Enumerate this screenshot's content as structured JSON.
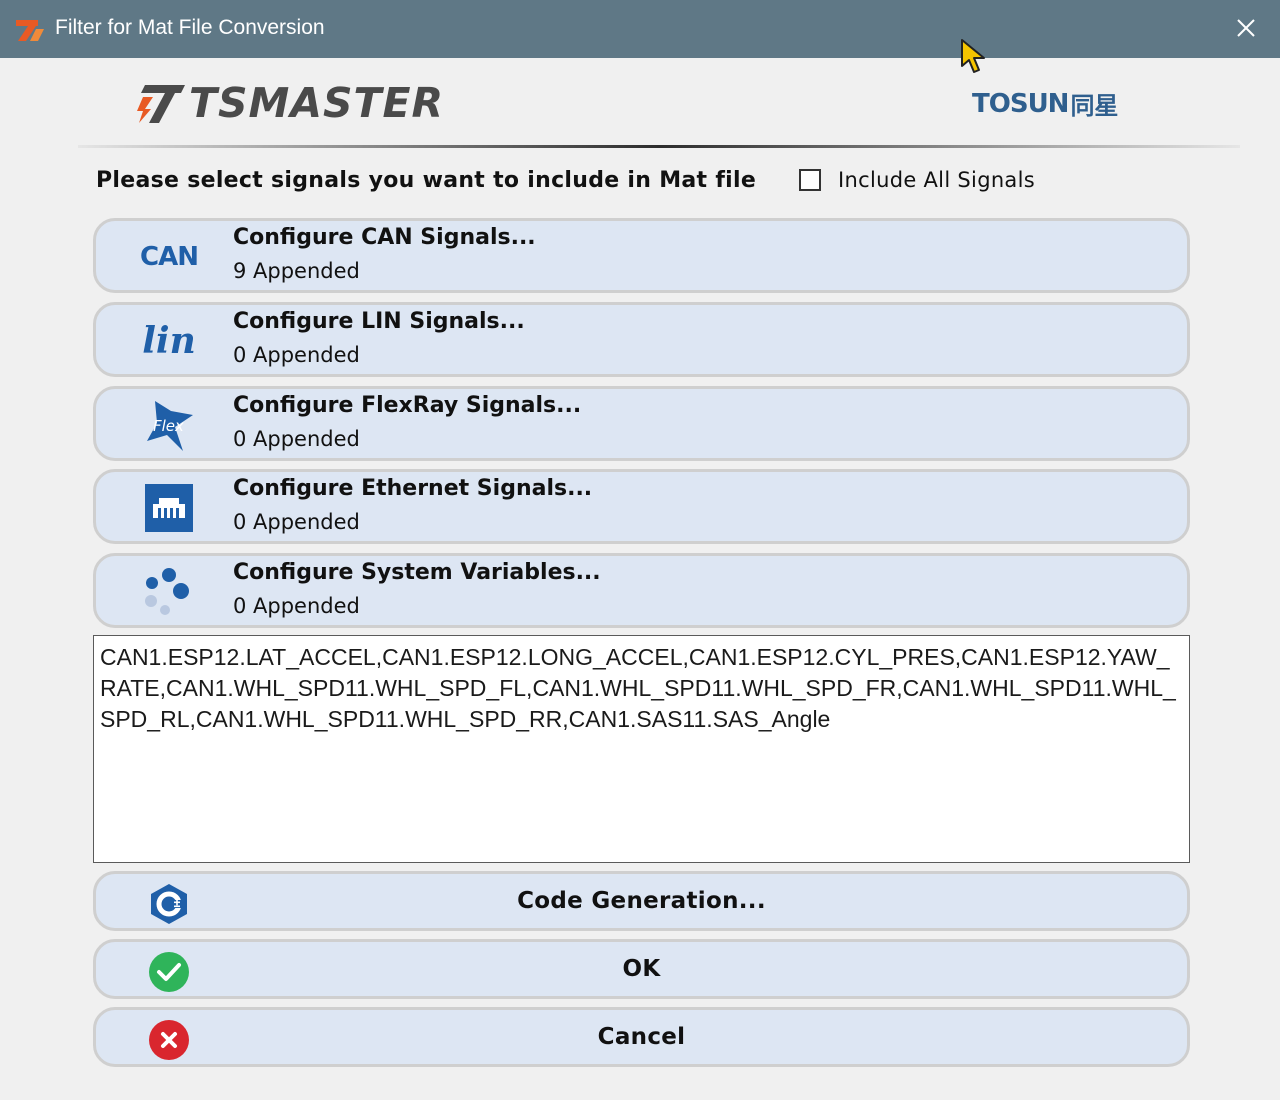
{
  "window": {
    "title": "Filter for Mat File Conversion",
    "title_bar_color": "#5f7886"
  },
  "logos": {
    "left_word": "TSMASTER",
    "right_word": "TOSUN",
    "right_cn": "同星"
  },
  "prompt": "Please select signals you want to include in Mat file",
  "include_all": {
    "label": "Include All Signals",
    "checked": false
  },
  "signal_groups": [
    {
      "icon": "can-icon",
      "icon_text": "CAN",
      "title": "Configure CAN Signals...",
      "status": "9 Appended"
    },
    {
      "icon": "lin-icon",
      "icon_text": "lin",
      "title": "Configure LIN Signals...",
      "status": "0 Appended"
    },
    {
      "icon": "flexray-icon",
      "icon_text": "Flex",
      "title": "Configure FlexRay Signals...",
      "status": "0 Appended"
    },
    {
      "icon": "ethernet-icon",
      "title": "Configure Ethernet Signals...",
      "status": "0 Appended"
    },
    {
      "icon": "system-variables-icon",
      "title": "Configure System Variables...",
      "status": "0 Appended"
    }
  ],
  "selected_signals": "CAN1.ESP12.LAT_ACCEL,CAN1.ESP12.LONG_ACCEL,CAN1.ESP12.CYL_PRES,CAN1.ESP12.YAW_RATE,CAN1.WHL_SPD11.WHL_SPD_FL,CAN1.WHL_SPD11.WHL_SPD_FR,CAN1.WHL_SPD11.WHL_SPD_RL,CAN1.WHL_SPD11.WHL_SPD_RR,CAN1.SAS11.SAS_Angle",
  "actions": {
    "code_generation": "Code Generation...",
    "ok": "OK",
    "cancel": "Cancel"
  },
  "colors": {
    "button_fill": "#dde6f3",
    "brand_blue": "#1f5fa8",
    "ok_green": "#2fb45a",
    "cancel_red": "#d9262e"
  }
}
